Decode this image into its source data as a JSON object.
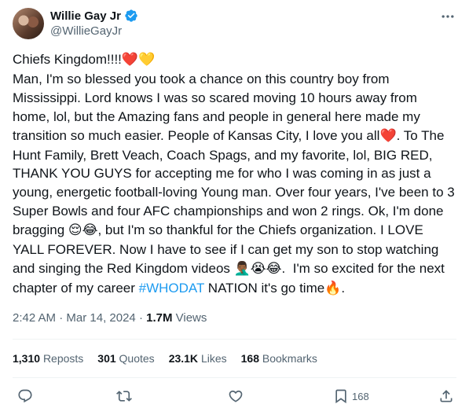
{
  "author": {
    "display_name": "Willie Gay Jr",
    "handle": "@WillieGayJr",
    "verified_color": "#1d9bf0"
  },
  "tweet": {
    "segments": [
      {
        "text": "Chiefs Kingdom!!!!"
      },
      {
        "text": "❤️",
        "emoji": true,
        "color": "#f4212e"
      },
      {
        "text": "💛",
        "emoji": true,
        "color": "#ffd43b"
      },
      {
        "text": "\nMan, I'm so blessed you took a chance on this country boy from Mississippi. Lord knows I was so scared moving 10 hours away from home, lol, but the Amazing fans and people in general here made my transition so much easier. People of Kansas City, I love you all"
      },
      {
        "text": "❤️",
        "emoji": true,
        "color": "#f4212e"
      },
      {
        "text": ". To The Hunt Family, Brett Veach, Coach Spags, and my favorite, lol, BIG RED, THANK YOU GUYS for accepting me for who I was coming in as just a young, energetic football-loving Young man. Over four years, I've been to 3 Super Bowls and four AFC championships and won 2 rings. Ok, I'm done bragging "
      },
      {
        "text": "😌😂",
        "emoji": true
      },
      {
        "text": ", but I'm so thankful for the Chiefs organization. I LOVE YALL FOREVER. Now I have to see if I can get my son to stop watching and singing the Red Kingdom videos "
      },
      {
        "text": "🤦🏾‍♂️😭😂",
        "emoji": true
      },
      {
        "text": ".  I'm so excited for the next chapter of my career "
      },
      {
        "text": "#WHODAT",
        "hashtag": true
      },
      {
        "text": " NATION it's go time"
      },
      {
        "text": "🔥",
        "emoji": true
      },
      {
        "text": "."
      }
    ]
  },
  "meta": {
    "time": "2:42 AM",
    "sep": " · ",
    "date": "Mar 14, 2024",
    "views_count": "1.7M",
    "views_label": " Views"
  },
  "stats": {
    "reposts_count": "1,310",
    "reposts_label": "Reposts",
    "quotes_count": "301",
    "quotes_label": "Quotes",
    "likes_count": "23.1K",
    "likes_label": "Likes",
    "bookmarks_count": "168",
    "bookmarks_label": "Bookmarks"
  },
  "actions": {
    "bookmark_count": "168",
    "icons": [
      "reply-icon",
      "repost-icon",
      "like-icon",
      "bookmark-icon",
      "share-icon"
    ]
  }
}
